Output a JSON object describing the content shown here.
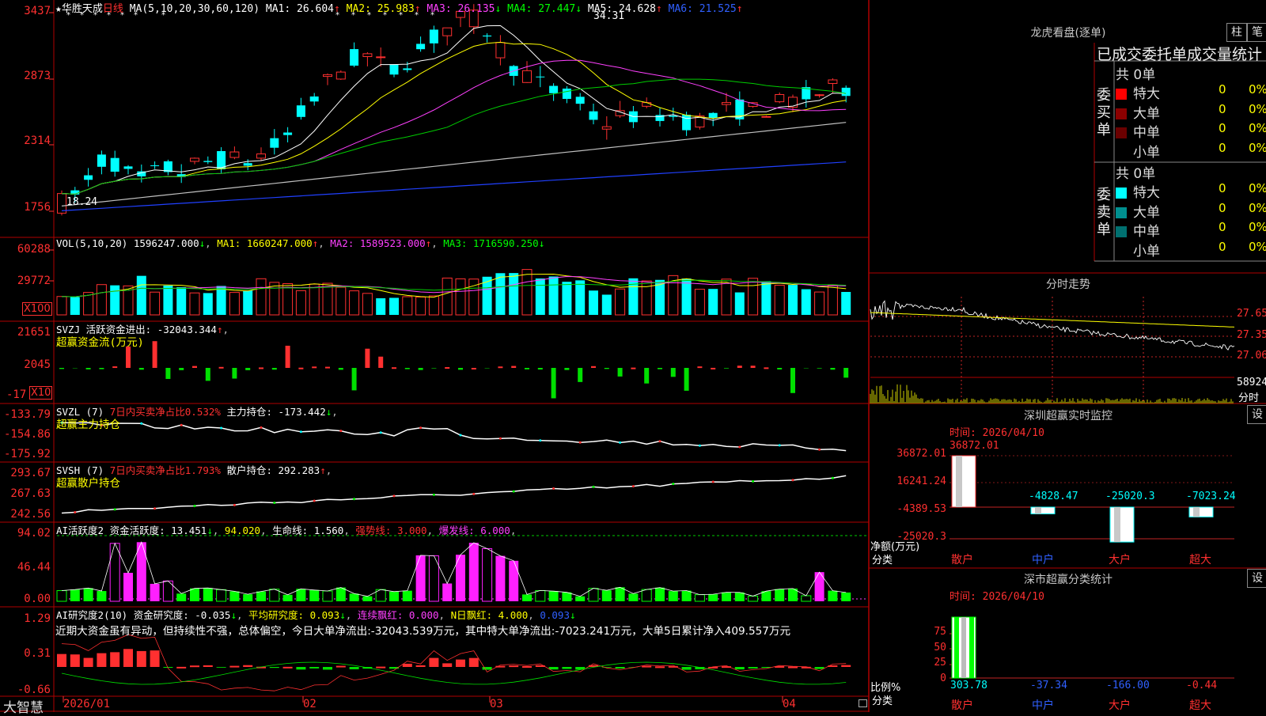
{
  "stock": {
    "name": "华胜天成",
    "period": "日线",
    "star": "★",
    "ma_label": "MA(5,10,20,30,60,120)",
    "ma1": "MA1: 26.604",
    "ma2": "MA2: 25.983",
    "ma3": "MA3: 26.135",
    "ma4": "MA4: 27.447",
    "ma5": "MA5: 24.628",
    "ma6": "MA6: 21.525",
    "peak": "34.31",
    "low": "18.24",
    "arrow_up": "↑",
    "arrow_down": "↓"
  },
  "price_axis": [
    "3437",
    "2873",
    "2314",
    "1756"
  ],
  "vol": {
    "title": "VOL(5,10,20)",
    "v": "1596247.000",
    "ma1": "MA1: 1660247.000",
    "ma2": "MA2: 1589523.000",
    "ma3": "MA3: 1716590.250",
    "axis": [
      "60288",
      "29772"
    ],
    "unit": "X100"
  },
  "svzj": {
    "title": "SVZJ",
    "label": "活跃资金进出: -32043.344",
    "sub": "超赢资金流(万元)",
    "axis": [
      "21651",
      "2045",
      "-17"
    ],
    "unit": "X10"
  },
  "svzl": {
    "title": "SVZL (7)",
    "ratio": "7日内买卖净占比0.532%",
    "hold": "主力持仓: -173.442",
    "sub": "超赢主力持仓",
    "axis": [
      "-133.79",
      "-154.86",
      "-175.92"
    ]
  },
  "svsh": {
    "title": "SVSH (7)",
    "ratio": "7日内买卖净占比1.793%",
    "hold": "散户持仓: 292.283",
    "sub": "超赢散户持仓",
    "axis": [
      "293.67",
      "267.63",
      "242.56"
    ]
  },
  "ai1": {
    "title": "AI活跃度2",
    "label": "资金活跃度: 13.451",
    "v2": "94.020",
    "life": "生命线: 1.560",
    "strong": "强势线: 3.000",
    "burst": "爆发线: 6.000",
    "axis": [
      "94.02",
      "46.44",
      "0.00"
    ]
  },
  "ai2": {
    "title": "AI研究度2(10)",
    "label": "资金研究度: -0.035",
    "avg": "平均研究度: 0.093",
    "cont": "连续飘红: 0.000",
    "nday": "N日飘红: 4.000",
    "nv": "0.093",
    "axis": [
      "1.29",
      "0.31",
      "-0.66"
    ],
    "comment": "近期大资金虽有异动，但持续性不强，总体偏空，今日大单净流出:-32043.539万元，其中特大单净流出:-7023.241万元，大单5日累计净入409.557万元"
  },
  "dates": [
    "2026/01",
    "02",
    "03",
    "04"
  ],
  "brand": "大智慧",
  "longhu": {
    "title": "龙虎看盘(逐单)",
    "btn1": "柱",
    "btn2": "笔",
    "subtitle": "已成交委托单成交量统计",
    "buy_side": "委买单",
    "sell_side": "委卖单",
    "buy_total": "共 0单",
    "sell_total": "共 0单",
    "buy_rows": [
      {
        "name": "特大",
        "count": "0",
        "pct": "0%",
        "color": "#ff0000"
      },
      {
        "name": "大单",
        "count": "0",
        "pct": "0%",
        "color": "#8b0000"
      },
      {
        "name": "中单",
        "count": "0",
        "pct": "0%",
        "color": "#6a0000"
      },
      {
        "name": "小单",
        "count": "0",
        "pct": "0%",
        "color": "#000000"
      }
    ],
    "sell_rows": [
      {
        "name": "特大",
        "count": "0",
        "pct": "0%",
        "color": "#00ffff"
      },
      {
        "name": "大单",
        "count": "0",
        "pct": "0%",
        "color": "#009090"
      },
      {
        "name": "中单",
        "count": "0",
        "pct": "0%",
        "color": "#007070"
      },
      {
        "name": "小单",
        "count": "0",
        "pct": "0%",
        "color": "#000000"
      }
    ]
  },
  "intraday": {
    "title": "分时走势",
    "axis": [
      "27.65",
      "27.35",
      "27.06"
    ],
    "vol": "58924",
    "vol_label": "分时"
  },
  "monitor": {
    "title": "深圳超赢实时监控",
    "btn": "设",
    "time": "时间: 2026/04/10",
    "axis": [
      "36872.01",
      "16241.24",
      "-4389.53",
      "-25020.3"
    ],
    "top": "36872.01",
    "values": [
      "-4828.47",
      "-25020.3",
      "-7023.24"
    ],
    "net_label": "净额(万元)",
    "cat_label": "分类",
    "cats": [
      "散户",
      "中户",
      "大户",
      "超大"
    ]
  },
  "classify": {
    "title": "深市超赢分类统计",
    "btn": "设",
    "time": "时间: 2026/04/10",
    "axis": [
      "75",
      "50",
      "25",
      "0"
    ],
    "ratio_label": "比例%",
    "cat_label": "分类",
    "values": [
      "303.78",
      "-37.34",
      "-166.00",
      "-0.44"
    ],
    "cats": [
      "散户",
      "中户",
      "大户",
      "超大"
    ]
  },
  "colors": {
    "up": "#ff3030",
    "down": "#00ffff",
    "grid": "#b00000",
    "ma1": "#ffffff",
    "ma2": "#ffff00",
    "ma3": "#ff40ff",
    "ma4": "#00cc00",
    "ma5": "#c0c0c0",
    "ma6": "#2040ff"
  }
}
